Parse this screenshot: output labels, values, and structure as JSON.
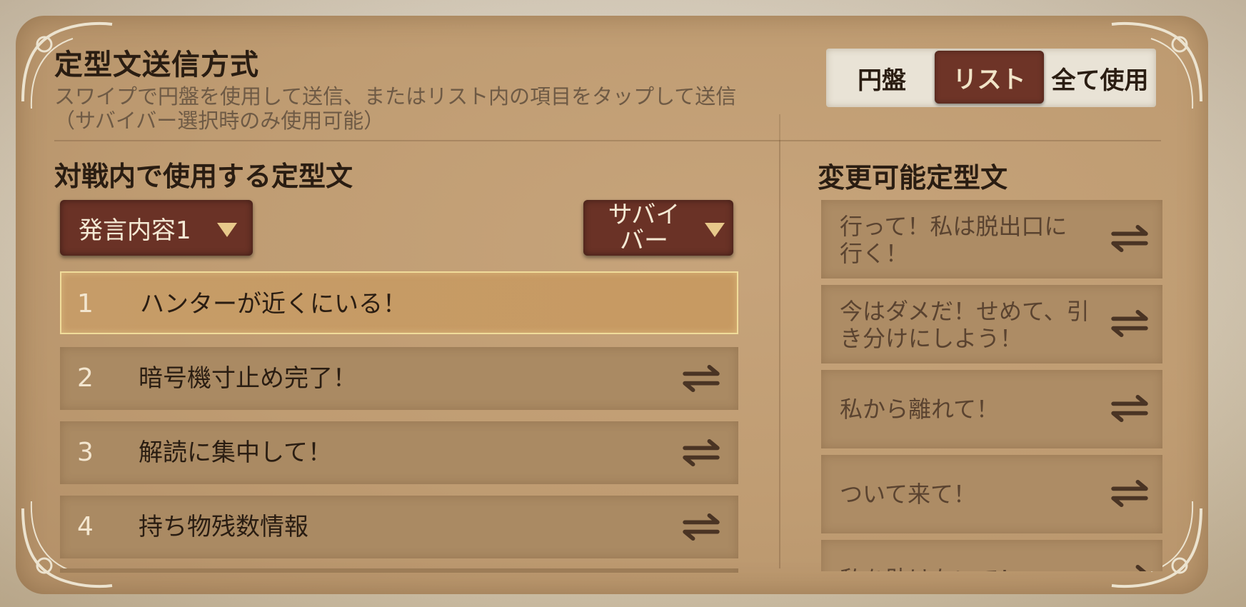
{
  "header": {
    "title": "定型文送信方式",
    "description": "スワイプで円盤を使用して送信、またはリスト内の項目をタップして送信（サバイバー選択時のみ使用可能）"
  },
  "mode_selector": {
    "options": [
      "円盤",
      "リスト",
      "全て使用"
    ],
    "selected": "リスト"
  },
  "left_section": {
    "title": "対戦内で使用する定型文",
    "slot_dropdown": "発言内容1",
    "role_dropdown": "サバイバー",
    "rows": [
      {
        "num": "1",
        "text": "ハンターが近くにいる！",
        "selected": true
      },
      {
        "num": "2",
        "text": "暗号機寸止め完了！"
      },
      {
        "num": "3",
        "text": "解読に集中して！"
      },
      {
        "num": "4",
        "text": "持ち物残数情報"
      }
    ]
  },
  "right_section": {
    "title": "変更可能定型文",
    "items": [
      {
        "text": "行って！私は脱出口に行く！"
      },
      {
        "text": "今はダメだ！せめて、引き分けにしよう！"
      },
      {
        "text": "私から離れて！"
      },
      {
        "text": "ついて来て！"
      },
      {
        "text": "私を助けないで！"
      }
    ]
  },
  "icons": {
    "swap": "swap-arrows-icon",
    "caret": "caret-down-icon"
  },
  "colors": {
    "panel": "#bf9c72",
    "button": "#6a3226",
    "selected_row": "#c69c68",
    "row": "#aa8a63"
  }
}
